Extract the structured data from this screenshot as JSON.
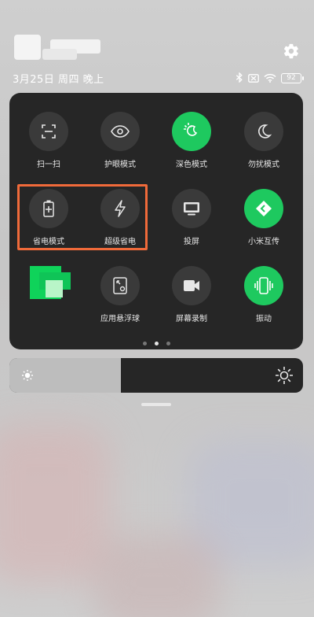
{
  "status": {
    "date": "3月25日 周四 晚上",
    "battery": "92"
  },
  "panel": {
    "tiles": [
      {
        "label": "扫一扫",
        "icon": "scan-icon",
        "active": false
      },
      {
        "label": "护眼模式",
        "icon": "eye-icon",
        "active": false
      },
      {
        "label": "深色模式",
        "icon": "dark-mode-icon",
        "active": true
      },
      {
        "label": "勿扰模式",
        "icon": "moon-icon",
        "active": false
      },
      {
        "label": "省电模式",
        "icon": "battery-saver-icon",
        "active": false
      },
      {
        "label": "超级省电",
        "icon": "lightning-icon",
        "active": false
      },
      {
        "label": "投屏",
        "icon": "screen-cast-icon",
        "active": false
      },
      {
        "label": "小米互传",
        "icon": "mi-share-icon",
        "active": true
      },
      {
        "label": "",
        "icon": "",
        "active": false
      },
      {
        "label": "应用悬浮球",
        "icon": "floating-ball-icon",
        "active": false
      },
      {
        "label": "屏幕录制",
        "icon": "screen-record-icon",
        "active": false
      },
      {
        "label": "振动",
        "icon": "vibrate-icon",
        "active": true
      }
    ],
    "page_indicator": {
      "pages": 3,
      "active_page": 2
    }
  },
  "brightness": {
    "level_percent": 38
  },
  "colors": {
    "accent": "#1ec95f",
    "panel": "#262626",
    "tile": "#3a3a3a",
    "highlight": "#f06a3a"
  }
}
